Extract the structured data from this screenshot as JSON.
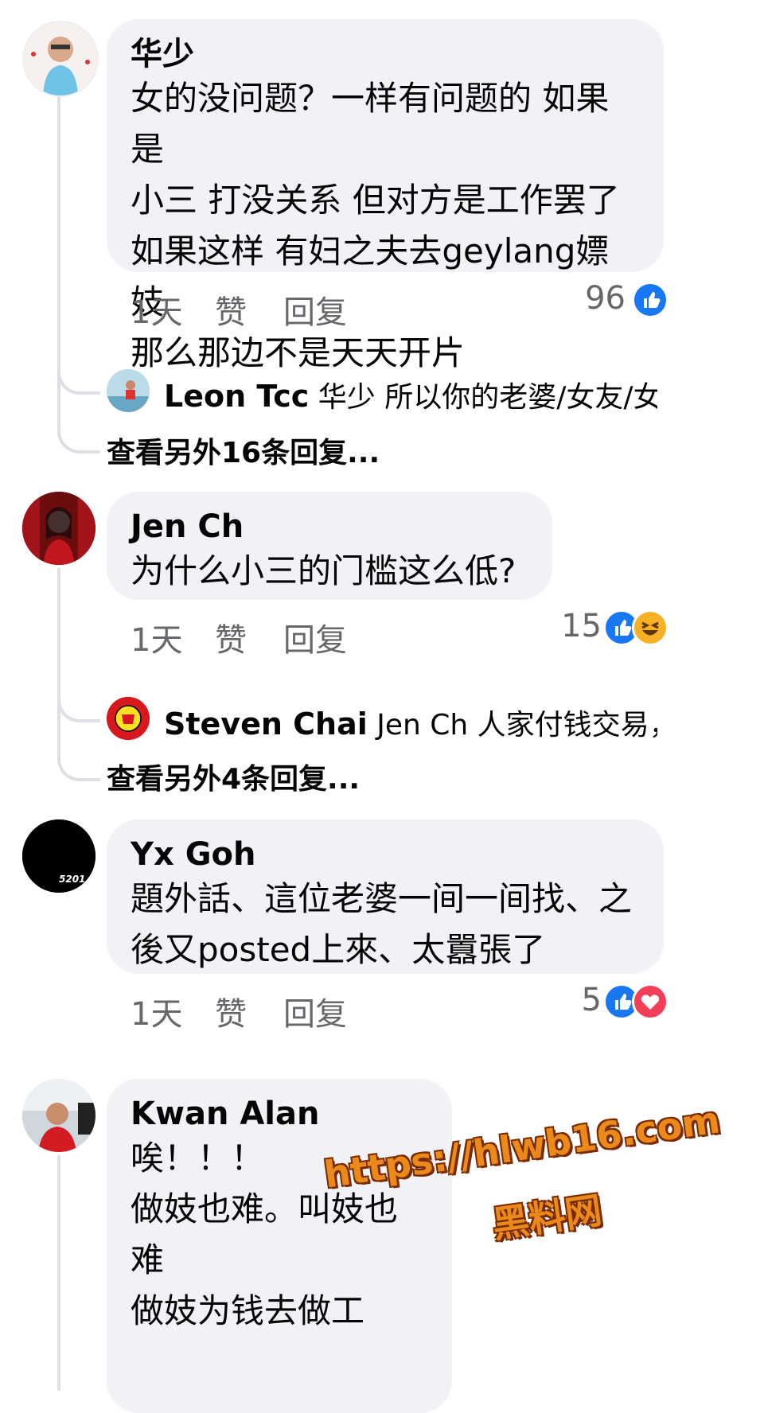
{
  "comments": [
    {
      "author": "华少",
      "text": "女的没问题？一样有问题的 如果是\n小三 打没关系 但对方是工作罢了\n如果这样 有妇之夫去geylang嫖妓\n那么那边不是天天开片",
      "time": "1天",
      "like_label": "赞",
      "reply_label": "回复",
      "reaction_count": "96",
      "reactions": [
        "like-icon"
      ],
      "reply_preview": {
        "author": "Leon Tcc",
        "text": "华少 所以你的老婆/女友/女..."
      },
      "more_replies": "查看另外16条回复..."
    },
    {
      "author": "Jen Ch",
      "text": "为什么小三的门槛这么低?",
      "time": "1天",
      "like_label": "赞",
      "reply_label": "回复",
      "reaction_count": "15",
      "reactions": [
        "like-icon",
        "haha-icon"
      ],
      "reply_preview": {
        "author": "Steven Chai",
        "text": "Jen Ch 人家付钱交易，..."
      },
      "more_replies": "查看另外4条回复..."
    },
    {
      "author": "Yx Goh",
      "avatar_text": "5201",
      "text": "題外話、這位老婆一间一间找、之\n後又posted上來、太囂張了",
      "time": "1天",
      "like_label": "赞",
      "reply_label": "回复",
      "reaction_count": "5",
      "reactions": [
        "like-icon",
        "love-icon"
      ]
    },
    {
      "author": "Kwan Alan",
      "text": "唉！！！\n做妓也难。叫妓也难\n做妓为钱去做工"
    }
  ],
  "watermark": {
    "url": "https://hlwb16.com",
    "name": "黑料网"
  },
  "colors": {
    "like": "#1877f2",
    "love": "#f33e58",
    "haha": "#f7b125",
    "bubble": "#f0f2f5",
    "muted": "#65676b"
  }
}
